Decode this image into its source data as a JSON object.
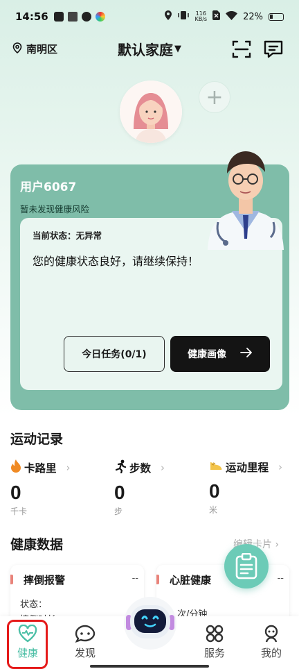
{
  "status_bar": {
    "time": "14:56",
    "net_speed_value": "116",
    "net_speed_unit": "KB/s",
    "battery": "22%"
  },
  "header": {
    "location": "南明区",
    "family": "默认家庭"
  },
  "health_card": {
    "user_name": "用户6067",
    "risk_text": "暂未发现健康风险",
    "state_label": "当前状态：无异常",
    "state_text": "您的健康状态良好，请继续保持！",
    "task_button": "今日任务(0/1)",
    "portrait_button": "健康画像"
  },
  "sport": {
    "title": "运动记录",
    "items": [
      {
        "label": "卡路里",
        "value": "0",
        "unit": "千卡"
      },
      {
        "label": "步数",
        "value": "0",
        "unit": "步"
      },
      {
        "label": "运动里程",
        "value": "0",
        "unit": "米"
      }
    ]
  },
  "health_data": {
    "title": "健康数据",
    "edit_label": "编辑卡片",
    "cards": [
      {
        "title": "摔倒报警",
        "value": "--",
        "line1": "状态：",
        "line2": "摔倒时长：--"
      },
      {
        "title": "心脏健康",
        "value": "--",
        "line1": "次/分钟",
        "line2": ""
      }
    ]
  },
  "nav": {
    "items": [
      {
        "label": "健康",
        "icon": "heart-pulse-icon"
      },
      {
        "label": "发现",
        "icon": "chat-bubble-icon"
      },
      {
        "label": "服务",
        "icon": "grid-icon"
      },
      {
        "label": "我的",
        "icon": "person-icon"
      }
    ]
  },
  "colors": {
    "accent": "#4cbfa6",
    "card": "#7fbda9",
    "highlight": "#e51a1a"
  }
}
